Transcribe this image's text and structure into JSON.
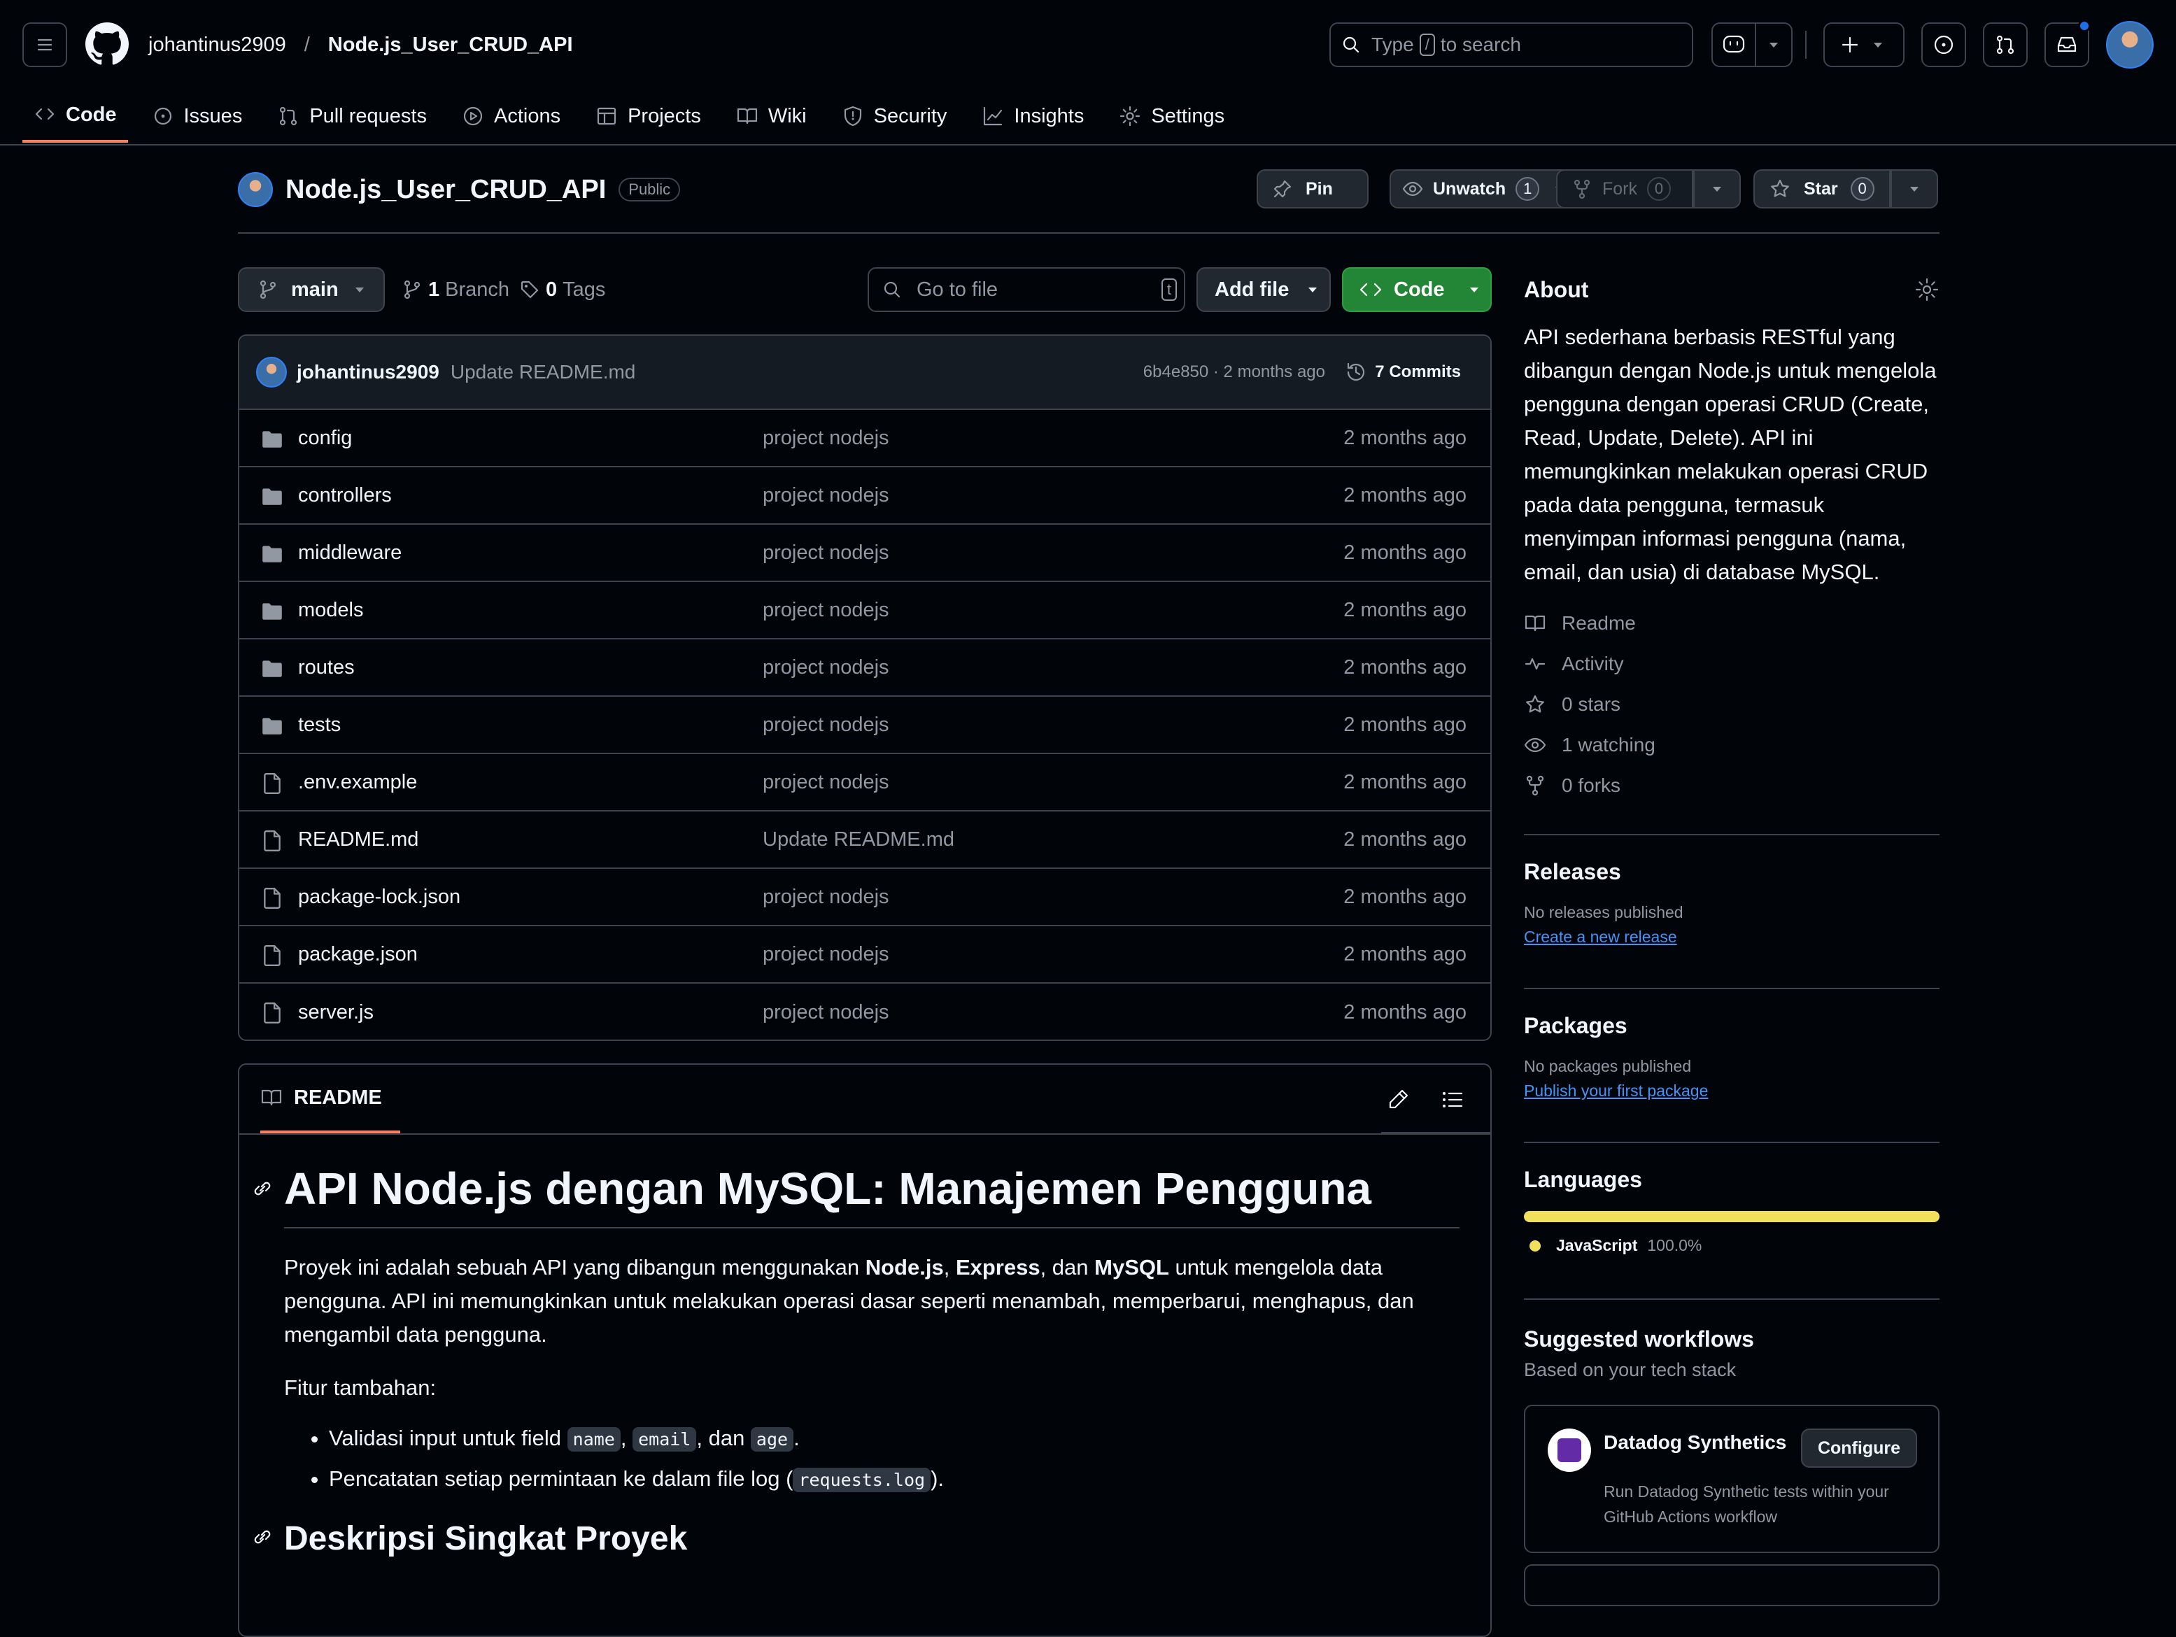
{
  "header": {
    "owner": "johantinus2909",
    "separator": "/",
    "repo": "Node.js_User_CRUD_API",
    "search_text_before": "Type",
    "search_key": "/",
    "search_text_after": "to search"
  },
  "nav": {
    "tabs": [
      {
        "label": "Code",
        "icon": "code-icon"
      },
      {
        "label": "Issues",
        "icon": "issue-icon"
      },
      {
        "label": "Pull requests",
        "icon": "pull-request-icon"
      },
      {
        "label": "Actions",
        "icon": "play-icon"
      },
      {
        "label": "Projects",
        "icon": "table-icon"
      },
      {
        "label": "Wiki",
        "icon": "book-icon"
      },
      {
        "label": "Security",
        "icon": "shield-icon"
      },
      {
        "label": "Insights",
        "icon": "graph-icon"
      },
      {
        "label": "Settings",
        "icon": "gear-icon"
      }
    ]
  },
  "repo": {
    "name": "Node.js_User_CRUD_API",
    "visibility": "Public",
    "pin_label": "Pin",
    "unwatch_label": "Unwatch",
    "watch_count": "1",
    "fork_label": "Fork",
    "fork_count": "0",
    "star_label": "Star",
    "star_count": "0"
  },
  "toolbar": {
    "branch": "main",
    "branches": "1",
    "branches_label": "Branch",
    "tags": "0",
    "tags_label": "Tags",
    "goto_placeholder": "Go to file",
    "goto_key": "t",
    "add_file": "Add file",
    "code": "Code"
  },
  "commit": {
    "author": "johantinus2909",
    "message": "Update README.md",
    "hash_time": "6b4e850 · 2 months ago",
    "commits": "7 Commits"
  },
  "files": [
    {
      "name": "config",
      "type": "folder",
      "message": "project nodejs",
      "date": "2 months ago"
    },
    {
      "name": "controllers",
      "type": "folder",
      "message": "project nodejs",
      "date": "2 months ago"
    },
    {
      "name": "middleware",
      "type": "folder",
      "message": "project nodejs",
      "date": "2 months ago"
    },
    {
      "name": "models",
      "type": "folder",
      "message": "project nodejs",
      "date": "2 months ago"
    },
    {
      "name": "routes",
      "type": "folder",
      "message": "project nodejs",
      "date": "2 months ago"
    },
    {
      "name": "tests",
      "type": "folder",
      "message": "project nodejs",
      "date": "2 months ago"
    },
    {
      "name": ".env.example",
      "type": "file",
      "message": "project nodejs",
      "date": "2 months ago"
    },
    {
      "name": "README.md",
      "type": "file",
      "message": "Update README.md",
      "date": "2 months ago"
    },
    {
      "name": "package-lock.json",
      "type": "file",
      "message": "project nodejs",
      "date": "2 months ago"
    },
    {
      "name": "package.json",
      "type": "file",
      "message": "project nodejs",
      "date": "2 months ago"
    },
    {
      "name": "server.js",
      "type": "file",
      "message": "project nodejs",
      "date": "2 months ago"
    }
  ],
  "readme": {
    "tab": "README",
    "h1": "API Node.js dengan MySQL: Manajemen Pengguna",
    "p1_a": "Proyek ini adalah sebuah API yang dibangun menggunakan ",
    "p1_node": "Node.js",
    "p1_b": ", ",
    "p1_express": "Express",
    "p1_c": ", dan ",
    "p1_mysql": "MySQL",
    "p1_d": " untuk mengelola data pengguna. API ini memungkinkan untuk melakukan operasi dasar seperti menambah, memperbarui, menghapus, dan mengambil data pengguna.",
    "p2": "Fitur tambahan:",
    "li1_a": "Validasi input untuk field ",
    "li1_name": "name",
    "li1_sep1": ", ",
    "li1_email": "email",
    "li1_sep2": ", dan ",
    "li1_age": "age",
    "li1_end": ".",
    "li2_a": "Pencatatan setiap permintaan ke dalam file log (",
    "li2_code": "requests.log",
    "li2_end": ").",
    "h2": "Deskripsi Singkat Proyek"
  },
  "about": {
    "title": "About",
    "description": "API sederhana berbasis RESTful yang dibangun dengan Node.js untuk mengelola pengguna dengan operasi CRUD (Create, Read, Update, Delete). API ini memungkinkan melakukan operasi CRUD pada data pengguna, termasuk menyimpan informasi pengguna (nama, email, dan usia) di database MySQL.",
    "links": [
      {
        "label": "Readme",
        "icon": "book-icon"
      },
      {
        "label": "Activity",
        "icon": "pulse-icon"
      },
      {
        "label": "0 stars",
        "icon": "star-icon"
      },
      {
        "label": "1 watching",
        "icon": "eye-icon"
      },
      {
        "label": "0 forks",
        "icon": "fork-icon"
      }
    ]
  },
  "releases": {
    "title": "Releases",
    "none": "No releases published",
    "link": "Create a new release"
  },
  "packages": {
    "title": "Packages",
    "none": "No packages published",
    "link": "Publish your first package"
  },
  "languages": {
    "title": "Languages",
    "name": "JavaScript",
    "percent": "100.0%",
    "fraction": 1.0,
    "color": "#f1e05a"
  },
  "workflows": {
    "title": "Suggested workflows",
    "subtitle": "Based on your tech stack",
    "card_title": "Datadog Synthetics",
    "card_button": "Configure",
    "card_desc": "Run Datadog Synthetic tests within your GitHub Actions workflow"
  },
  "colors": {
    "accent": "#f78166",
    "primary_button": "#238636",
    "link": "#4493f8",
    "notification": "#1f6feb"
  }
}
